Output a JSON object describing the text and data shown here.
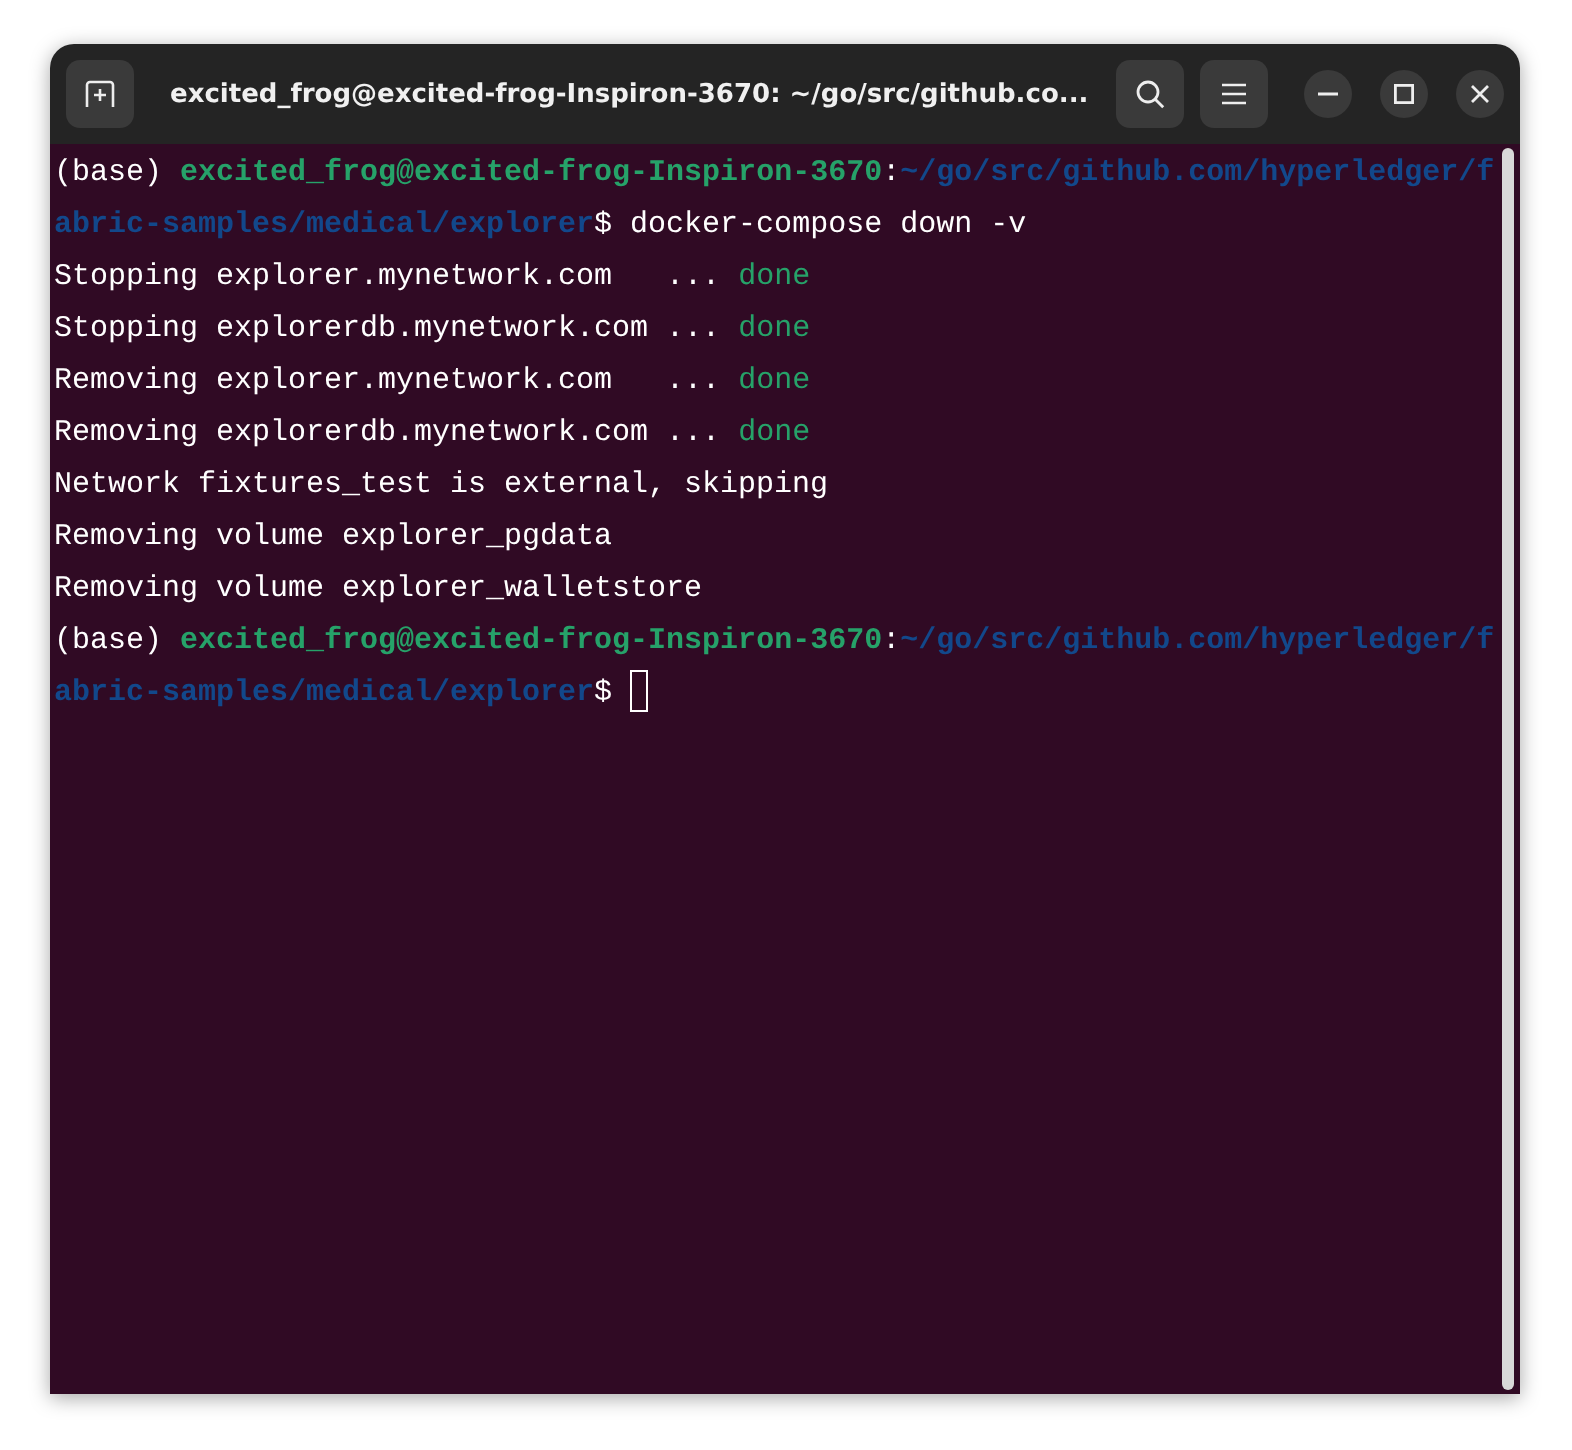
{
  "window": {
    "title": "excited_frog@excited-frog-Inspiron-3670: ~/go/src/github.co..."
  },
  "terminal": {
    "cursor": true,
    "lines": [
      {
        "segments": [
          {
            "kind": "plain",
            "text": "(base) "
          },
          {
            "kind": "user",
            "text": "excited_frog@excited-frog-Inspiron-3670"
          },
          {
            "kind": "plain",
            "text": ":"
          },
          {
            "kind": "path",
            "text": "~/go/src/github.com/hyperledger/fabric-samples/medical/explorer"
          },
          {
            "kind": "plain",
            "text": "$ docker-compose down -v"
          }
        ]
      },
      {
        "segments": [
          {
            "kind": "plain",
            "text": "Stopping explorer.mynetwork.com   ... "
          },
          {
            "kind": "done",
            "text": "done"
          }
        ]
      },
      {
        "segments": [
          {
            "kind": "plain",
            "text": "Stopping explorerdb.mynetwork.com ... "
          },
          {
            "kind": "done",
            "text": "done"
          }
        ]
      },
      {
        "segments": [
          {
            "kind": "plain",
            "text": "Removing explorer.mynetwork.com   ... "
          },
          {
            "kind": "done",
            "text": "done"
          }
        ]
      },
      {
        "segments": [
          {
            "kind": "plain",
            "text": "Removing explorerdb.mynetwork.com ... "
          },
          {
            "kind": "done",
            "text": "done"
          }
        ]
      },
      {
        "segments": [
          {
            "kind": "plain",
            "text": "Network fixtures_test is external, skipping"
          }
        ]
      },
      {
        "segments": [
          {
            "kind": "plain",
            "text": "Removing volume explorer_pgdata"
          }
        ]
      },
      {
        "segments": [
          {
            "kind": "plain",
            "text": "Removing volume explorer_walletstore"
          }
        ]
      },
      {
        "segments": [
          {
            "kind": "plain",
            "text": "(base) "
          },
          {
            "kind": "user",
            "text": "excited_frog@excited-frog-Inspiron-3670"
          },
          {
            "kind": "plain",
            "text": ":"
          },
          {
            "kind": "path",
            "text": "~/go/src/github.com/hyperledger/fabric-samples/medical/explorer"
          },
          {
            "kind": "plain",
            "text": "$ "
          }
        ]
      }
    ]
  }
}
